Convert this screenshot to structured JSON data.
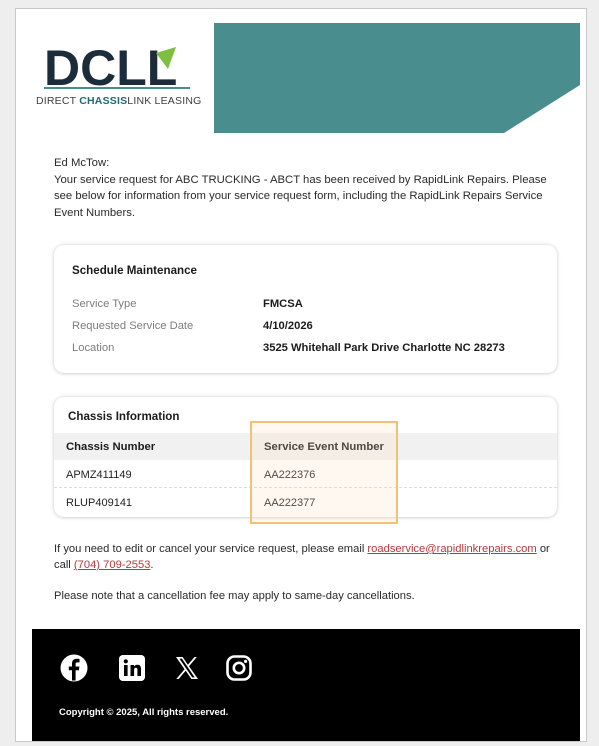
{
  "logo": {
    "wordmark": "DCLL",
    "tagline_prefix": "DIRECT ",
    "tagline_bold": "CHASSIS",
    "tagline_suffix": "LINK LEASING"
  },
  "colors": {
    "teal": "#4a8d8f",
    "logo_navy": "#1d2c3a",
    "accent_green": "#7fbf3f",
    "link_red": "#b23b3b",
    "highlight": "#f0c276",
    "footer": "#000000"
  },
  "greeting": "Ed McTow:",
  "intro": "Your service request for ABC TRUCKING - ABCT has been received by RapidLink Repairs. Please see below for information from your service request form, including the RapidLink Repairs Service Event Numbers.",
  "maintenance": {
    "title": "Schedule Maintenance",
    "fields": [
      {
        "label": "Service Type",
        "value": "FMCSA"
      },
      {
        "label": "Requested Service Date",
        "value": "4/10/2026"
      },
      {
        "label": "Location",
        "value": "3525 Whitehall Park Drive Charlotte NC 28273"
      }
    ]
  },
  "chassis": {
    "title": "Chassis Information",
    "headers": [
      "Chassis Number",
      "Service Event Number"
    ],
    "rows": [
      [
        "APMZ411149",
        "AA222376"
      ],
      [
        "RLUP409141",
        "AA222377"
      ]
    ]
  },
  "contact": {
    "prefix": "If you need to edit or cancel your service request, please email ",
    "email": "roadservice@rapidlinkrepairs.com",
    "middle": " or call ",
    "phone": "(704) 709-2553",
    "suffix": "."
  },
  "note": "Please note that a cancellation fee may apply to same-day cancellations.",
  "footer": {
    "social_icons": [
      "facebook-icon",
      "linkedin-icon",
      "x-icon",
      "instagram-icon"
    ],
    "copyright": "Copyright © 2025, All rights reserved."
  }
}
